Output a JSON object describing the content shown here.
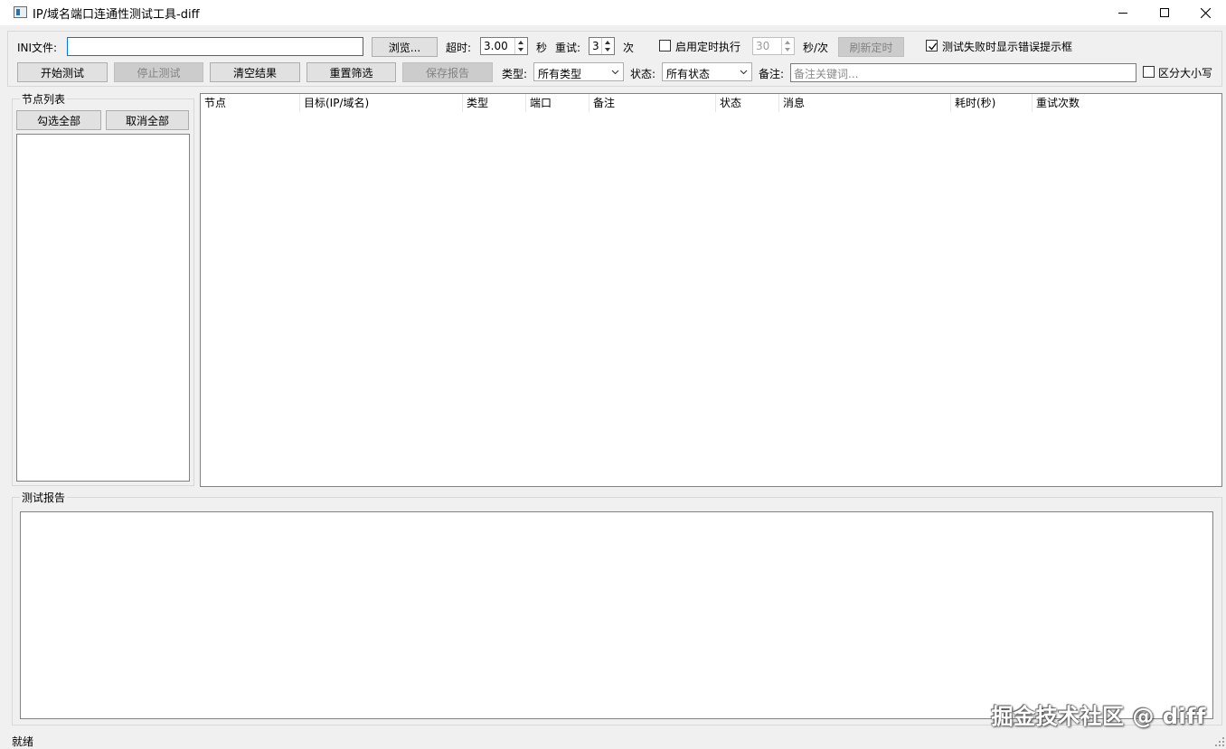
{
  "window": {
    "title": "IP/域名端口连通性测试工具-diff",
    "minimize_icon": "minimize-icon",
    "maximize_icon": "maximize-icon",
    "close_icon": "close-icon"
  },
  "toolbar": {
    "ini_label": "INI文件:",
    "ini_value": "",
    "browse_label": "浏览...",
    "timeout_label": "超时:",
    "timeout_value": "3.00",
    "timeout_unit": "秒",
    "retry_label": "重试:",
    "retry_value": "3",
    "retry_unit": "次",
    "schedule_checkbox_label": "启用定时执行",
    "schedule_checked": false,
    "schedule_interval_value": "30",
    "schedule_unit": "秒/次",
    "refresh_schedule_label": "刷新定时",
    "show_error_checkbox_label": "测试失败时显示错误提示框",
    "show_error_checked": true,
    "start_label": "开始测试",
    "stop_label": "停止测试",
    "clear_label": "清空结果",
    "reset_filter_label": "重置筛选",
    "save_report_label": "保存报告",
    "type_label": "类型:",
    "type_selected": "所有类型",
    "status_label": "状态:",
    "status_selected": "所有状态",
    "note_label": "备注:",
    "note_placeholder": "备注关键词...",
    "case_checkbox_label": "区分大小写",
    "case_checked": false
  },
  "node_panel": {
    "title": "节点列表",
    "select_all_label": "勾选全部",
    "deselect_all_label": "取消全部",
    "items": []
  },
  "results_table": {
    "columns": [
      "节点",
      "目标(IP/域名)",
      "类型",
      "端口",
      "备注",
      "状态",
      "消息",
      "耗时(秒)",
      "重试次数"
    ],
    "rows": []
  },
  "report": {
    "title": "测试报告",
    "content": ""
  },
  "statusbar": {
    "text": "就绪"
  },
  "watermark": "掘金技术社区 @ diff"
}
